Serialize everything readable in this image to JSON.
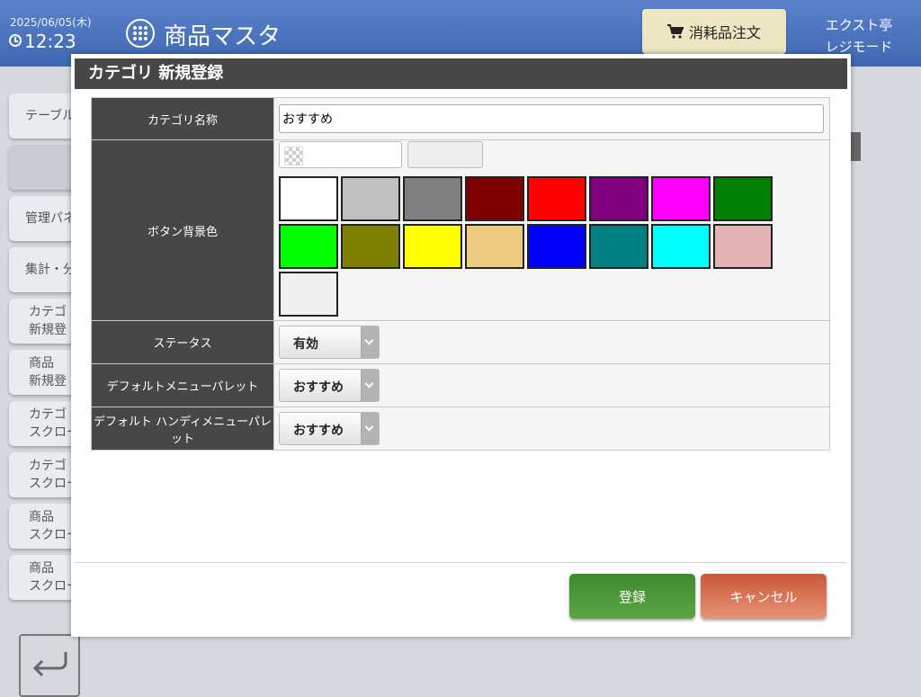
{
  "header": {
    "date": "2025/06/05(木)",
    "time": "12:23",
    "title": "商品マスタ",
    "order_button": "消耗品注文",
    "store_name": "エクスト亭",
    "mode": "レジモード"
  },
  "sidebar": {
    "items": [
      {
        "line1": "テーブル",
        "line2": ""
      },
      {
        "line1": "",
        "line2": ""
      },
      {
        "line1": "管理パネ",
        "line2": ""
      },
      {
        "line1": "集計・分",
        "line2": ""
      },
      {
        "line1": "カテゴ",
        "line2": "新規登"
      },
      {
        "line1": "商品",
        "line2": "新規登"
      },
      {
        "line1": "カテゴ",
        "line2": "スクロー"
      },
      {
        "line1": "カテゴ",
        "line2": "スクロー"
      },
      {
        "line1": "商品",
        "line2": "スクロー"
      },
      {
        "line1": "商品",
        "line2": "スクロー"
      }
    ]
  },
  "modal": {
    "title": "カテゴリ 新規登録",
    "fields": {
      "name_label": "カテゴリ名称",
      "name_value": "おすすめ",
      "color_label": "ボタン背景色",
      "status_label": "ステータス",
      "status_value": "有効",
      "palette_label": "デフォルトメニューパレット",
      "palette_value": "おすすめ",
      "handy_palette_label": "デフォルト ハンディメニューパレット",
      "handy_palette_value": "おすすめ"
    },
    "swatch_colors": [
      "#ffffff",
      "#c0c0c0",
      "#808080",
      "#800000",
      "#ff0000",
      "#800080",
      "#ff00ff",
      "#008000",
      "#00ff00",
      "#808000",
      "#ffff00",
      "#eecb80",
      "#0000ff",
      "#008080",
      "#00ffff",
      "#e4b2b2",
      "#f0f0f0"
    ],
    "preview_color": "#eeeeee",
    "submit_button": "登録",
    "cancel_button": "キャンセル"
  }
}
